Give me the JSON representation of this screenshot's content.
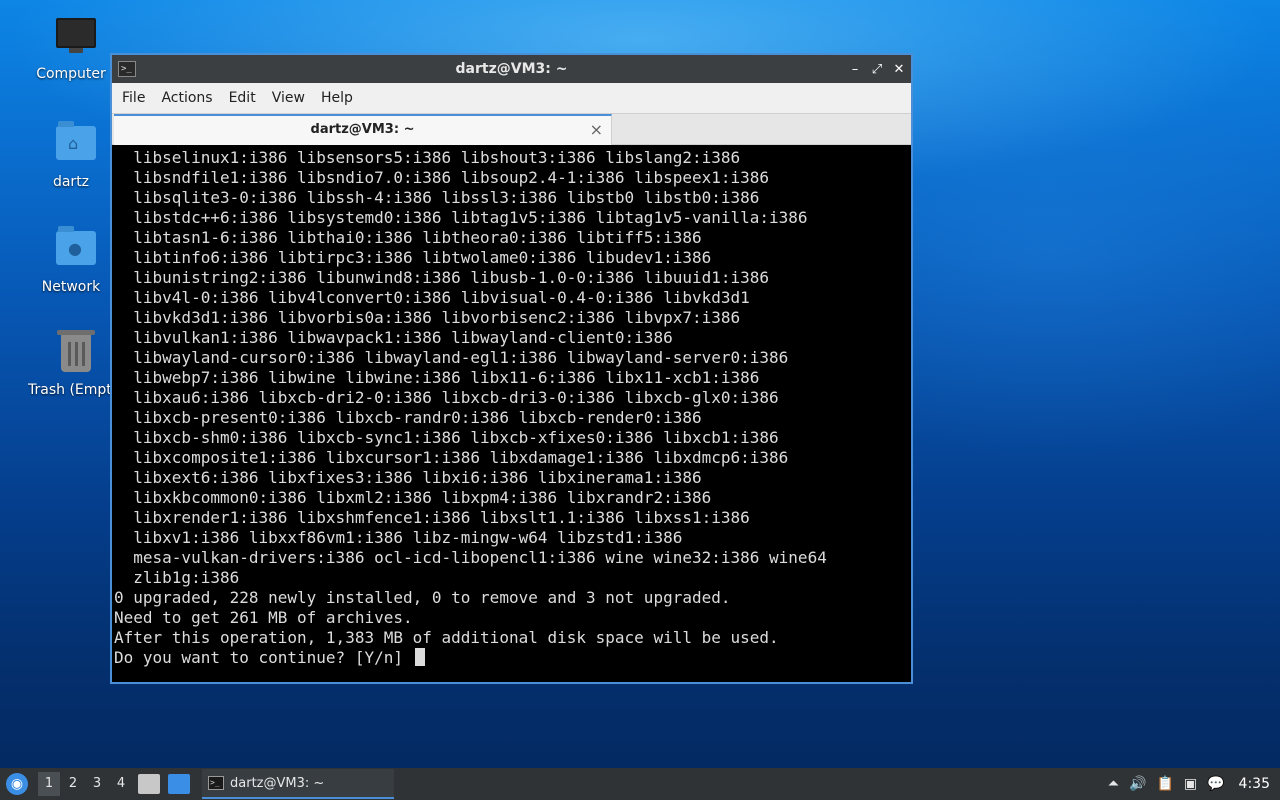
{
  "desktop": {
    "icons": [
      {
        "label": "Computer",
        "icon": "computer-icon"
      },
      {
        "label": "dartz",
        "icon": "home-folder-icon"
      },
      {
        "label": "Network",
        "icon": "network-folder-icon"
      },
      {
        "label": "Trash (Empty)",
        "icon": "trash-icon"
      }
    ]
  },
  "window": {
    "title": "dartz@VM3: ~",
    "menu": [
      "File",
      "Actions",
      "Edit",
      "View",
      "Help"
    ],
    "tab_label": "dartz@VM3: ~",
    "tab_close": "×",
    "controls": {
      "minimize": "–",
      "maximize": "⤢",
      "close": "✕"
    }
  },
  "terminal": {
    "lines": [
      "  libselinux1:i386 libsensors5:i386 libshout3:i386 libslang2:i386",
      "  libsndfile1:i386 libsndio7.0:i386 libsoup2.4-1:i386 libspeex1:i386",
      "  libsqlite3-0:i386 libssh-4:i386 libssl3:i386 libstb0 libstb0:i386",
      "  libstdc++6:i386 libsystemd0:i386 libtag1v5:i386 libtag1v5-vanilla:i386",
      "  libtasn1-6:i386 libthai0:i386 libtheora0:i386 libtiff5:i386",
      "  libtinfo6:i386 libtirpc3:i386 libtwolame0:i386 libudev1:i386",
      "  libunistring2:i386 libunwind8:i386 libusb-1.0-0:i386 libuuid1:i386",
      "  libv4l-0:i386 libv4lconvert0:i386 libvisual-0.4-0:i386 libvkd3d1",
      "  libvkd3d1:i386 libvorbis0a:i386 libvorbisenc2:i386 libvpx7:i386",
      "  libvulkan1:i386 libwavpack1:i386 libwayland-client0:i386",
      "  libwayland-cursor0:i386 libwayland-egl1:i386 libwayland-server0:i386",
      "  libwebp7:i386 libwine libwine:i386 libx11-6:i386 libx11-xcb1:i386",
      "  libxau6:i386 libxcb-dri2-0:i386 libxcb-dri3-0:i386 libxcb-glx0:i386",
      "  libxcb-present0:i386 libxcb-randr0:i386 libxcb-render0:i386",
      "  libxcb-shm0:i386 libxcb-sync1:i386 libxcb-xfixes0:i386 libxcb1:i386",
      "  libxcomposite1:i386 libxcursor1:i386 libxdamage1:i386 libxdmcp6:i386",
      "  libxext6:i386 libxfixes3:i386 libxi6:i386 libxinerama1:i386",
      "  libxkbcommon0:i386 libxml2:i386 libxpm4:i386 libxrandr2:i386",
      "  libxrender1:i386 libxshmfence1:i386 libxslt1.1:i386 libxss1:i386",
      "  libxv1:i386 libxxf86vm1:i386 libz-mingw-w64 libzstd1:i386",
      "  mesa-vulkan-drivers:i386 ocl-icd-libopencl1:i386 wine wine32:i386 wine64",
      "  zlib1g:i386",
      "0 upgraded, 228 newly installed, 0 to remove and 3 not upgraded.",
      "Need to get 261 MB of archives.",
      "After this operation, 1,383 MB of additional disk space will be used."
    ],
    "prompt": "Do you want to continue? [Y/n] "
  },
  "taskbar": {
    "workspaces": [
      "1",
      "2",
      "3",
      "4"
    ],
    "active_workspace": "1",
    "task_label": "dartz@VM3: ~",
    "clock": "4:35"
  },
  "colors": {
    "accent": "#4a90d9",
    "terminal_bg": "#000000",
    "terminal_fg": "#dcdcdc",
    "titlebar": "#3c3f41",
    "taskbar": "#2f3336"
  }
}
